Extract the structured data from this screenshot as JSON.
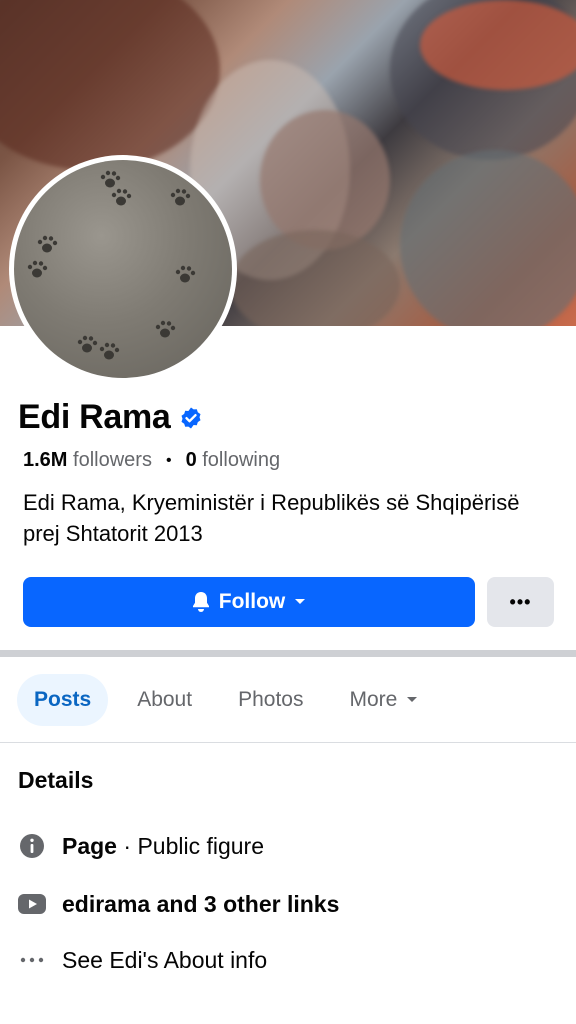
{
  "profile": {
    "name": "Edi Rama",
    "followers_count": "1.6M",
    "followers_label": "followers",
    "following_count": "0",
    "following_label": "following",
    "bio": "Edi Rama, Kryeministër i Republikës së Shqipërisë prej Shtatorit 2013"
  },
  "actions": {
    "follow_label": "Follow",
    "more_label": "•••"
  },
  "tabs": [
    {
      "label": "Posts",
      "active": true
    },
    {
      "label": "About",
      "active": false
    },
    {
      "label": "Photos",
      "active": false
    },
    {
      "label": "More",
      "active": false
    }
  ],
  "details": {
    "title": "Details",
    "page_label": "Page",
    "page_separator": " · ",
    "page_category": "Public figure",
    "links_text": "edirama and 3 other links",
    "about_text": "See Edi's About info"
  },
  "icons": {
    "verified": "verified-badge-icon",
    "bell": "bell-icon",
    "info": "info-icon",
    "youtube": "youtube-icon",
    "more": "more-dots-icon"
  },
  "colors": {
    "primary": "#0866ff",
    "tab_active_bg": "#ebf5ff",
    "tab_active_text": "#0a66c2",
    "secondary_button": "#e4e6eb"
  }
}
